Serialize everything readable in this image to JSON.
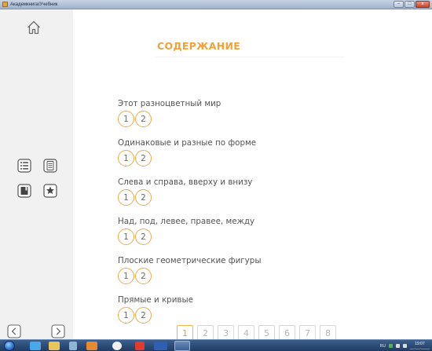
{
  "window": {
    "title": "Академкнига/Учебник",
    "min_label": "–",
    "max_label": "□",
    "close_label": "x"
  },
  "sidebar": {
    "home": "home-icon",
    "tools": [
      "list-icon",
      "document-icon",
      "notebook-icon",
      "star-icon"
    ],
    "nav_prev": "arrow-left-icon",
    "nav_next": "arrow-right-icon"
  },
  "content": {
    "heading": "СОДЕРЖАНИЕ",
    "toc": [
      {
        "title": "Этот разноцветный мир",
        "parts": [
          "1",
          "2"
        ]
      },
      {
        "title": "Одинаковые и разные по форме",
        "parts": [
          "1",
          "2"
        ]
      },
      {
        "title": "Слева и справа, вверху и внизу",
        "parts": [
          "1",
          "2"
        ]
      },
      {
        "title": "Над, под, левее, правее, между",
        "parts": [
          "1",
          "2"
        ]
      },
      {
        "title": "Плоские геометрические фигуры",
        "parts": [
          "1",
          "2"
        ]
      },
      {
        "title": "Прямые и кривые",
        "parts": [
          "1",
          "2"
        ]
      }
    ],
    "pages": [
      "1",
      "2",
      "3",
      "4",
      "5",
      "6",
      "7",
      "8"
    ],
    "active_page": "1"
  },
  "taskbar": {
    "lang": "RU",
    "time": "19:07",
    "date": "__.__.____"
  },
  "colors": {
    "accent": "#f0a13a",
    "ring": "#efaa45",
    "sidebar": "#f1f1f1",
    "text": "#545454"
  }
}
